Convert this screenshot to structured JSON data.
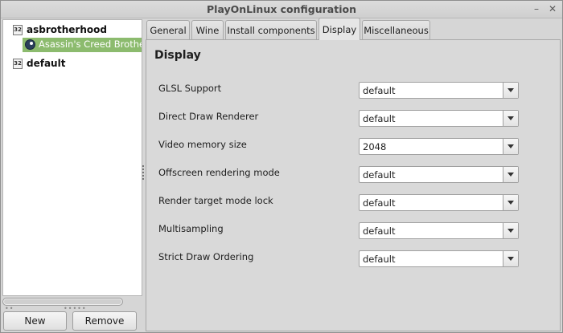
{
  "window": {
    "title": "PlayOnLinux configuration",
    "minimize_glyph": "–",
    "close_glyph": "✕"
  },
  "tree": {
    "prefixes": [
      {
        "name": "asbrotherhood",
        "badge": "32",
        "children": [
          {
            "name": "Asassin's Creed Brotherh",
            "icon": "steam-icon",
            "selected": true
          }
        ]
      },
      {
        "name": "default",
        "badge": "32",
        "children": []
      }
    ]
  },
  "buttons": {
    "new_label": "New",
    "remove_label": "Remove"
  },
  "tabs": [
    {
      "label": "General",
      "active": false
    },
    {
      "label": "Wine",
      "active": false
    },
    {
      "label": "Install components",
      "active": false
    },
    {
      "label": "Display",
      "active": true
    },
    {
      "label": "Miscellaneous",
      "active": false
    }
  ],
  "display": {
    "heading": "Display",
    "settings": [
      {
        "label": "GLSL Support",
        "value": "default"
      },
      {
        "label": "Direct Draw Renderer",
        "value": "default"
      },
      {
        "label": "Video memory size",
        "value": "2048"
      },
      {
        "label": "Offscreen rendering mode",
        "value": "default"
      },
      {
        "label": "Render target mode lock",
        "value": "default"
      },
      {
        "label": "Multisampling",
        "value": "default"
      },
      {
        "label": "Strict Draw Ordering",
        "value": "default"
      }
    ]
  },
  "colors": {
    "selection": "#8cbb6e",
    "window_bg": "#d6d6d6"
  }
}
